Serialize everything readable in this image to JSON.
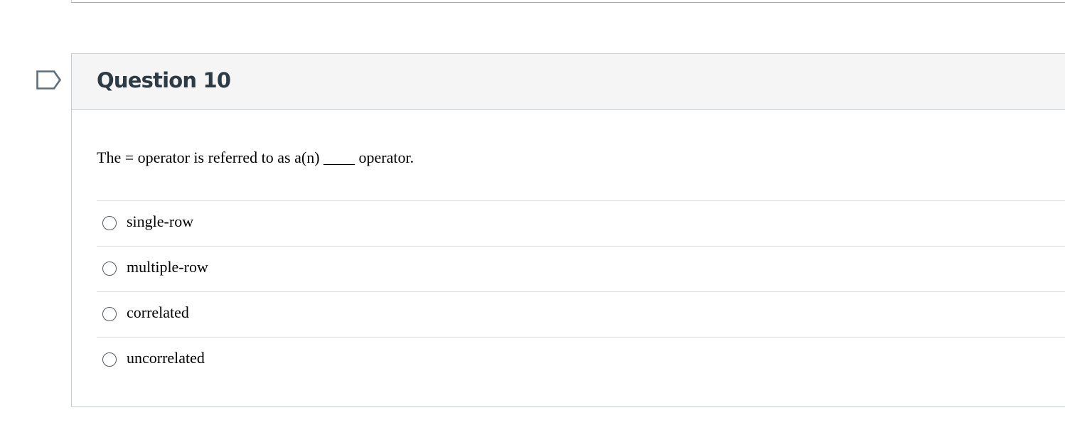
{
  "question": {
    "title": "Question 10",
    "text": "The = operator is referred to as a(n) ____ operator.",
    "answers": [
      {
        "label": "single-row",
        "selected": false
      },
      {
        "label": "multiple-row",
        "selected": false
      },
      {
        "label": "correlated",
        "selected": false
      },
      {
        "label": "uncorrelated",
        "selected": false
      }
    ]
  },
  "colors": {
    "title_text": "#2d3b45",
    "header_background": "#f5f5f5",
    "border": "#c7cdd1",
    "flag_icon": "#2d3b45"
  }
}
